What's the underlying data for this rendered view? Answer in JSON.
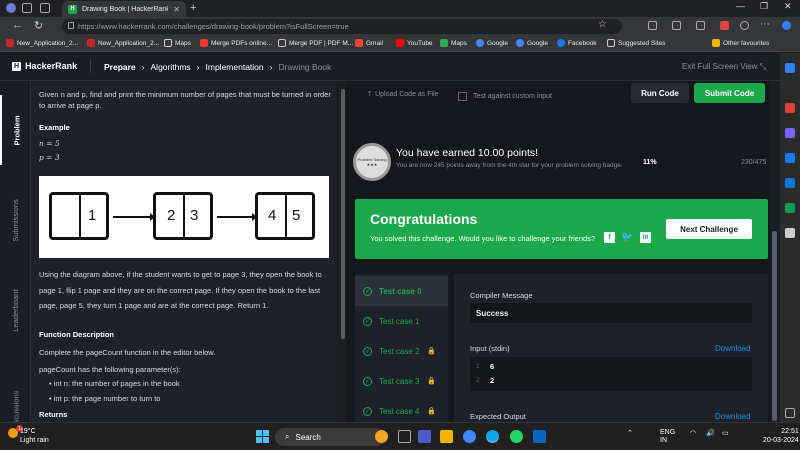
{
  "browser": {
    "tab_title": "Drawing Book | HackerRank",
    "url": "https://www.hackerrank.com/challenges/drawing-book/problem?isFullScreen=true",
    "bookmarks": [
      "New_Application_2...",
      "New_Application_2...",
      "Maps",
      "Merge PDFs online...",
      "Merge PDF | PDF M...",
      "Gmail",
      "YouTube",
      "Maps",
      "Google",
      "Google",
      "Facebook",
      "Suggested Sites",
      "Other favourites"
    ]
  },
  "header": {
    "logo": "HackerRank",
    "logo_mark": "H",
    "crumbs": [
      "Prepare",
      "Algorithms",
      "Implementation",
      "Drawing Book"
    ],
    "exit_fullscreen": "Exit Full Screen View"
  },
  "rail": {
    "problem": "Problem",
    "submissions": "Submissions",
    "leaderboard": "Leaderboard",
    "discussions": "Discussions"
  },
  "problem": {
    "intro": "Given n and p, find and print the minimum number of pages that must be turned in order to arrive at page p.",
    "example_heading": "Example",
    "n_line": "n = 5",
    "p_line": "p = 3",
    "pages": [
      "1",
      "2",
      "3",
      "4",
      "5"
    ],
    "explanation": "Using the diagram above, if the student wants to get to page 3, they open the book to page 1, flip 1 page and they are on the correct page. If they open the book to the last page, page 5, they turn 1 page and are at the correct page. Return 1.",
    "func_heading": "Function Description",
    "func_desc": "Complete the pageCount function in the editor below.",
    "params_intro": "pageCount has the following parameter(s):",
    "param1": "int n: the number of pages in the book",
    "param2": "int p: the page number to turn to",
    "returns_heading": "Returns"
  },
  "editor": {
    "upload": "Upload Code as File",
    "test_custom": "Test against custom input",
    "run": "Run Code",
    "submit": "Submit Code"
  },
  "result": {
    "badge_label": "Problem Solving",
    "badge_stars": "★★★",
    "earned": "You have earned 10.00 points!",
    "earned_sub": "You are now 245 points away from the 4th star for your problem solving badge.",
    "percent": "11%",
    "progress": "230/475",
    "congrats_title": "Congratulations",
    "congrats_sub": "You solved this challenge. Would you like to challenge your friends?",
    "next_challenge": "Next Challenge"
  },
  "testcases": [
    {
      "label": "Test case 0",
      "locked": false
    },
    {
      "label": "Test case 1",
      "locked": false
    },
    {
      "label": "Test case 2",
      "locked": true
    },
    {
      "label": "Test case 3",
      "locked": true
    },
    {
      "label": "Test case 4",
      "locked": true
    }
  ],
  "detail": {
    "compiler_label": "Compiler Message",
    "compiler_value": "Success",
    "input_label": "Input (stdin)",
    "download": "Download",
    "input_lines": [
      "6",
      "2"
    ],
    "expected_label": "Expected Output"
  },
  "taskbar": {
    "temp": "19°C",
    "weather": "Light rain",
    "weather_badge": "1",
    "search": "Search",
    "lang1": "ENG",
    "lang2": "IN",
    "time": "22:51",
    "date": "20-03-2024"
  },
  "colors": {
    "accent": "#1ba94c",
    "link": "#1a8fe3"
  }
}
